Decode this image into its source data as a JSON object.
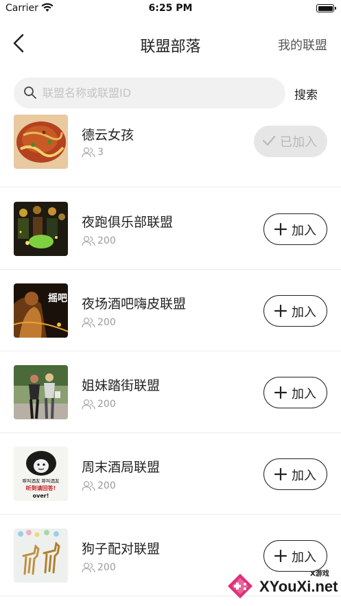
{
  "status_bar": {
    "carrier": "Carrier",
    "time": "6:25 PM"
  },
  "nav": {
    "title": "联盟部落",
    "right_label": "我的联盟"
  },
  "search": {
    "placeholder": "联盟名称或联盟ID",
    "value": "",
    "button_label": "搜索"
  },
  "alliances": [
    {
      "name": "德云女孩",
      "members": "3",
      "button_label": "已加入",
      "joined": true,
      "thumb": "food-photo"
    },
    {
      "name": "夜跑俱乐部联盟",
      "members": "200",
      "button_label": "加入",
      "joined": false,
      "thumb": "night-party-photo"
    },
    {
      "name": "夜场酒吧嗨皮联盟",
      "members": "200",
      "button_label": "加入",
      "joined": false,
      "thumb": "bar-photo"
    },
    {
      "name": "姐妹踏街联盟",
      "members": "200",
      "button_label": "加入",
      "joined": false,
      "thumb": "street-photo"
    },
    {
      "name": "周末酒局联盟",
      "members": "200",
      "button_label": "加入",
      "joined": false,
      "thumb": "meme-image"
    },
    {
      "name": "狗子配对联盟",
      "members": "200",
      "button_label": "加入",
      "joined": false,
      "thumb": "dogs-drawing"
    }
  ],
  "thumb_texts": {
    "bar": "摇吧",
    "meme_line1": "呼叫酒友 呼叫酒友",
    "meme_line2": "听到请回答!",
    "meme_line3": "over!"
  },
  "watermark": {
    "text": "XYouXi.net",
    "sub": "X游戏"
  },
  "colors": {
    "text_primary": "#222222",
    "text_secondary": "#9a9a9a",
    "search_bg": "#f1f1f1",
    "joined_bg": "#e6e6e6"
  }
}
